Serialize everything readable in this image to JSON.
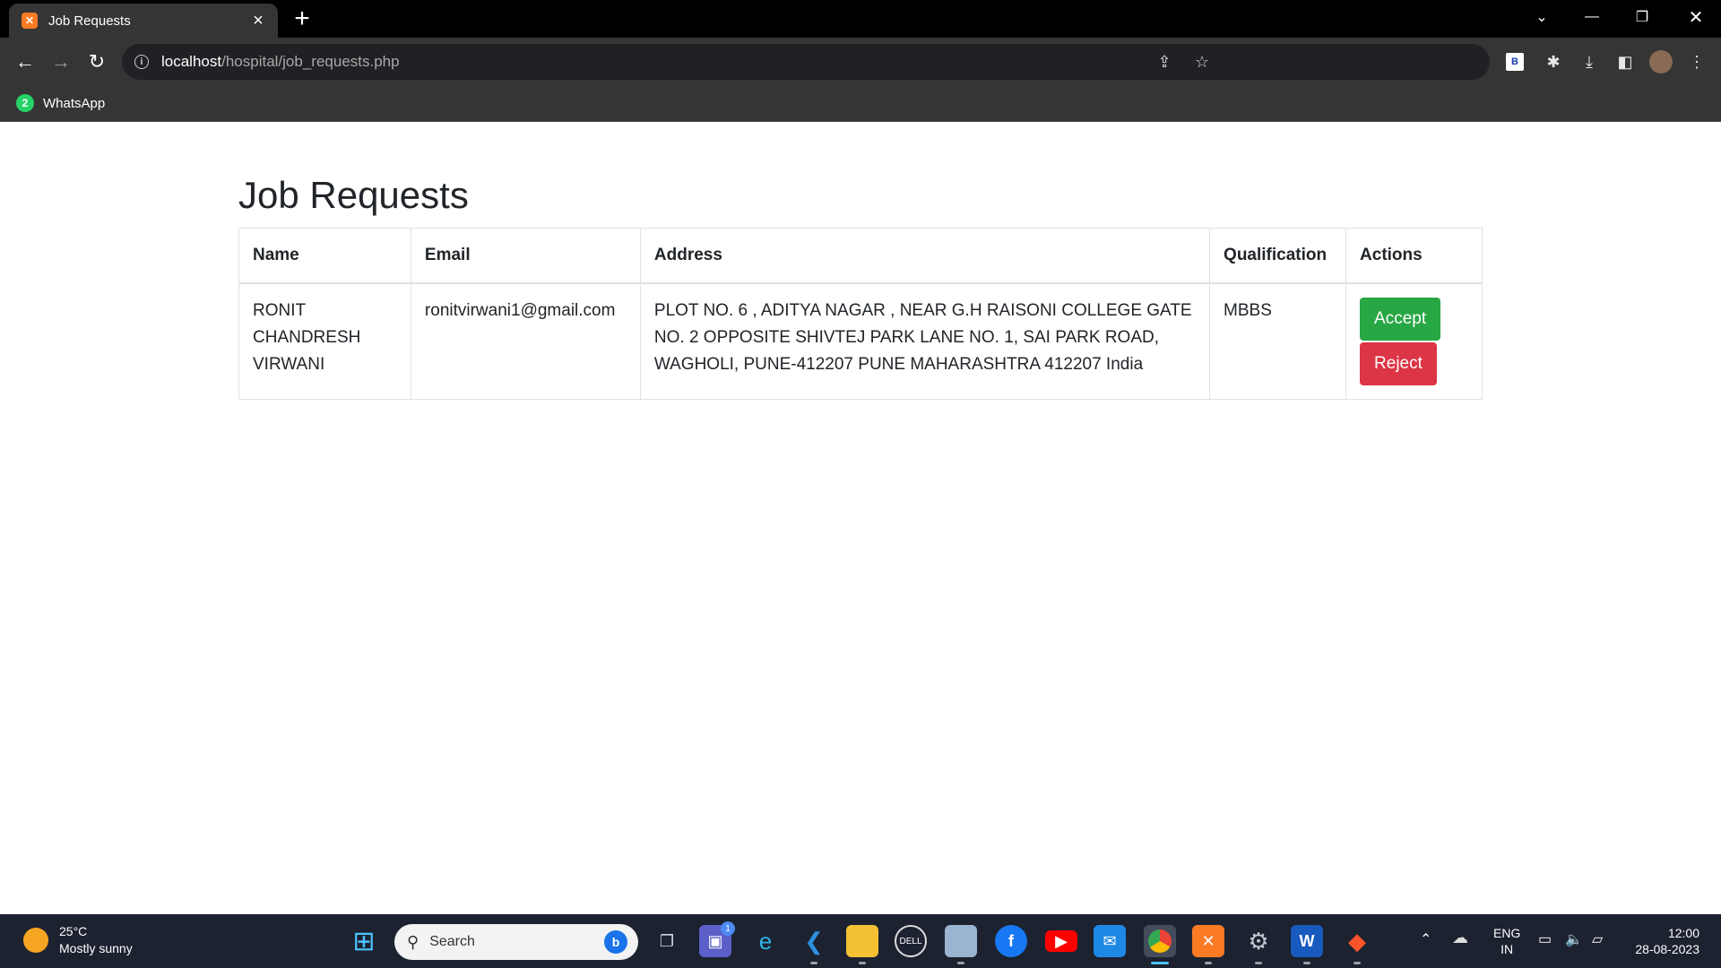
{
  "browser": {
    "tab_title": "Job Requests",
    "url_host": "localhost",
    "url_path": "/hospital/job_requests.php",
    "bookmark_label": "WhatsApp",
    "bookmark_badge": "2"
  },
  "page": {
    "title": "Job Requests",
    "table": {
      "headers": [
        "Name",
        "Email",
        "Address",
        "Qualification",
        "Actions"
      ],
      "rows": [
        {
          "name": "RONIT CHANDRESH VIRWANI",
          "email": "ronitvirwani1@gmail.com",
          "address": "PLOT NO. 6 , ADITYA NAGAR , NEAR G.H RAISONI COLLEGE GATE NO. 2 OPPOSITE SHIVTEJ PARK LANE NO. 1, SAI PARK ROAD, WAGHOLI, PUNE-412207 PUNE MAHARASHTRA 412207 India",
          "qualification": "MBBS",
          "accept_label": "Accept",
          "reject_label": "Reject"
        }
      ]
    }
  },
  "taskbar": {
    "temperature": "25°C",
    "weather": "Mostly sunny",
    "search_placeholder": "Search",
    "teams_badge": "1",
    "lang_line1": "ENG",
    "lang_line2": "IN",
    "time": "12:00",
    "date": "28-08-2023"
  },
  "colors": {
    "accept": "#28a745",
    "reject": "#dc3545",
    "chrome_dark": "#353535"
  }
}
